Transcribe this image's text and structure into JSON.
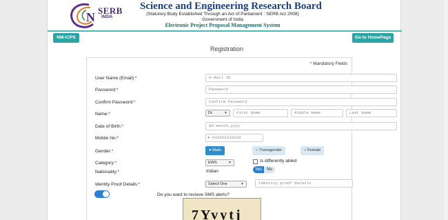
{
  "header": {
    "logo_main": "SERB",
    "logo_sub": "INDIA",
    "title": "Science and Engineering Research Board",
    "subtitle": "(Statutory Body Established Through an Act of Parliament : SERB Act 2008)",
    "gov": "Government of India",
    "system": "Electronic Project Proposal Management System"
  },
  "nav": {
    "left_button": "NM-ICPS",
    "right_button": "Go to HomePage"
  },
  "page_title": "Registration",
  "mandatory": "* Mandatory Fields",
  "form": {
    "username_label": "User Name (Email):",
    "username_placeholder": "E-Mail ID",
    "password_label": "Password:",
    "password_placeholder": "Password",
    "confirm_label": "Confirm Password:",
    "confirm_placeholder": "Confirm Password",
    "name_label": "Name:",
    "salutation": "Dr.",
    "first_placeholder": "First Name",
    "middle_placeholder": "Middle Name",
    "last_placeholder": "Last Name",
    "dob_label": "Date of Birth:",
    "dob_placeholder": "dd month,yyyy",
    "mobile_label": "Mobile No:",
    "mobile_prefix": "+",
    "mobile_placeholder": "91XXXXXXXXXX",
    "gender_label": "Gender:",
    "gender_options": [
      "Male",
      "Transgender",
      "Female"
    ],
    "gender_selected": "Male",
    "category_label": "Category:",
    "category_value": "EWS",
    "differently_abled": "Is differently abled",
    "nationality_label": "Nationality:",
    "nationality_value": "Indian",
    "yes_label": "Yes",
    "no_label": "No",
    "identity_label": "Identity Proof Details:",
    "identity_select": "Select One",
    "identity_placeholder": "Identity proof details",
    "sms_label": "Do you want to recieve SMS alerts?",
    "captcha_text": "7Yvytj"
  }
}
